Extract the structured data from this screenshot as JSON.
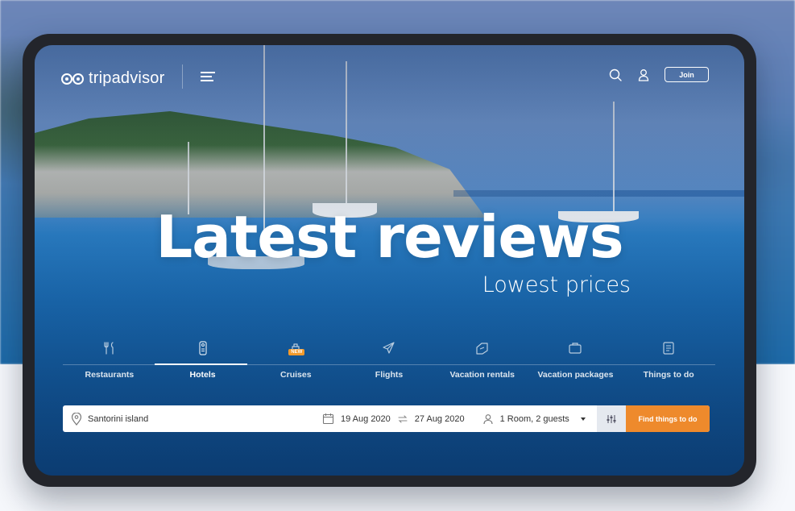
{
  "header": {
    "logo_text": "tripadvisor",
    "join_label": "Join"
  },
  "hero": {
    "title": "Latest reviews",
    "subtitle": "Lowest prices"
  },
  "tabs": [
    {
      "label": "Restaurants",
      "icon": "restaurant-icon"
    },
    {
      "label": "Hotels",
      "icon": "hotel-door-tag-icon",
      "active": true
    },
    {
      "label": "Cruises",
      "icon": "cruise-ship-icon",
      "badge": "NEW"
    },
    {
      "label": "Flights",
      "icon": "plane-icon"
    },
    {
      "label": "Vacation rentals",
      "icon": "rental-tag-icon"
    },
    {
      "label": "Vacation packages",
      "icon": "suitcase-icon"
    },
    {
      "label": "Things to do",
      "icon": "list-icon"
    }
  ],
  "search": {
    "location_value": "Santorini island",
    "check_in": "19 Aug 2020",
    "check_out": "27 Aug 2020",
    "guests": "1 Room, 2 guests",
    "submit_label": "Find things to do"
  },
  "colors": {
    "accent": "#ee8a2c",
    "badge": "#f39a2b",
    "device_frame": "#23252b"
  }
}
